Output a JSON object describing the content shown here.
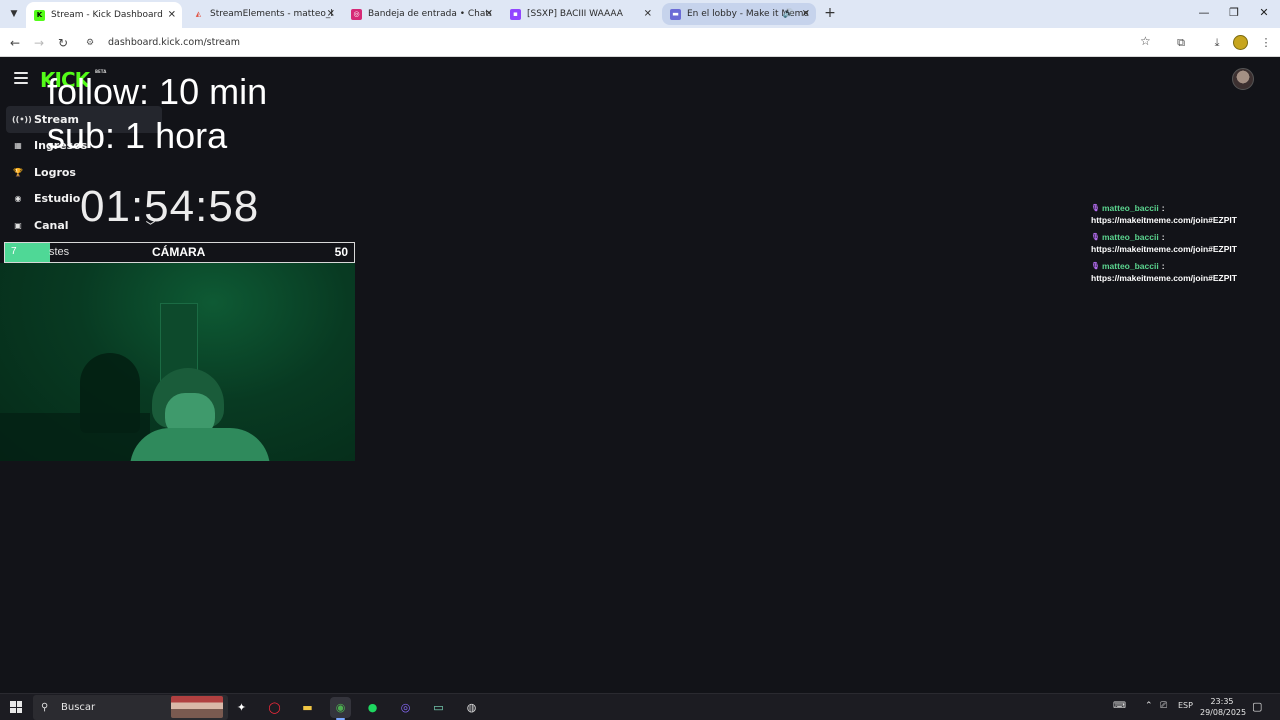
{
  "browser": {
    "tabs": [
      {
        "title": "Stream - Kick Dashboard",
        "icon": "kick-favicon",
        "color": "#53fc18",
        "state": "active"
      },
      {
        "title": "StreamElements - matteo_bacc",
        "icon": "streamelements-favicon",
        "color": "#e05040",
        "state": "normal"
      },
      {
        "title": "Bandeja de entrada • Chats",
        "icon": "instagram-favicon",
        "color": "#d62976",
        "state": "normal"
      },
      {
        "title": "[SSXP] BACIII WAAAA",
        "icon": "twitch-favicon",
        "color": "#9146ff",
        "state": "normal"
      },
      {
        "title": "En el lobby - Make it Meme",
        "icon": "meme-favicon",
        "color": "#6b6bd6",
        "state": "hover"
      }
    ],
    "url": "dashboard.kick.com/stream"
  },
  "page": {
    "logo": "KICK",
    "logo_badge": "BETA",
    "sidebar": [
      {
        "label": "Stream",
        "icon": "broadcast-icon",
        "active": true
      },
      {
        "label": "Ingresos",
        "icon": "chart-icon",
        "active": false
      },
      {
        "label": "Logros",
        "icon": "trophy-icon",
        "active": false
      },
      {
        "label": "Estudio",
        "icon": "studio-icon",
        "active": false
      },
      {
        "label": "Canal",
        "icon": "channel-icon",
        "active": false,
        "expandable": true
      }
    ],
    "overlay": {
      "line1": "follow: 10 min",
      "line2": "sub: 1 hora",
      "timer": "01:54:58"
    },
    "goal": {
      "start_value": "7",
      "left_label": "stes",
      "title": "CÁMARA",
      "end_value": "50",
      "progress_fraction": 0.13,
      "fill_color": "#4fd896"
    },
    "chat": [
      {
        "user": "matteo_baccii",
        "colon": ":",
        "text": "https://makeitmeme.com/join#EZPIT"
      },
      {
        "user": "matteo_baccii",
        "colon": ":",
        "text": "https://makeitmeme.com/join#EZPIT"
      },
      {
        "user": "matteo_baccii",
        "colon": ":",
        "text": "https://makeitmeme.com/join#EZPIT"
      }
    ]
  },
  "taskbar": {
    "search_label": "Buscar",
    "lang": "ESP",
    "time": "23:35",
    "date": "29/08/2025"
  }
}
